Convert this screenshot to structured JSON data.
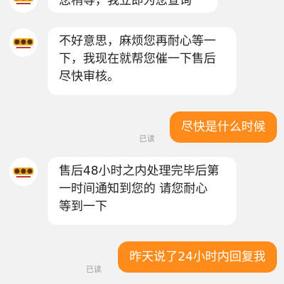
{
  "messages": [
    {
      "from": "agent",
      "lines": [
        "您稍等，我立即为您查询"
      ]
    },
    {
      "from": "agent",
      "lines": [
        "不好意思，麻烦您再耐心等一",
        "下，我现在就帮您催一下售后",
        "尽快审核。"
      ]
    },
    {
      "from": "user",
      "text": "尽快是什么时候",
      "status": "已读"
    },
    {
      "from": "agent",
      "lines": [
        "售后48小时之内处理完毕后第",
        "一时间通知到您的 请您耐心",
        "等到一下"
      ]
    },
    {
      "from": "user",
      "text": "昨天说了24小时内回复我",
      "status": "已读"
    }
  ],
  "colors": {
    "background": "#f2f2f2",
    "user_bubble": "#ff8c1a",
    "agent_bubble": "#ffffff",
    "read_text": "#9a9a9a"
  },
  "icons": {
    "agent_avatar": "shop-logo-icon"
  }
}
